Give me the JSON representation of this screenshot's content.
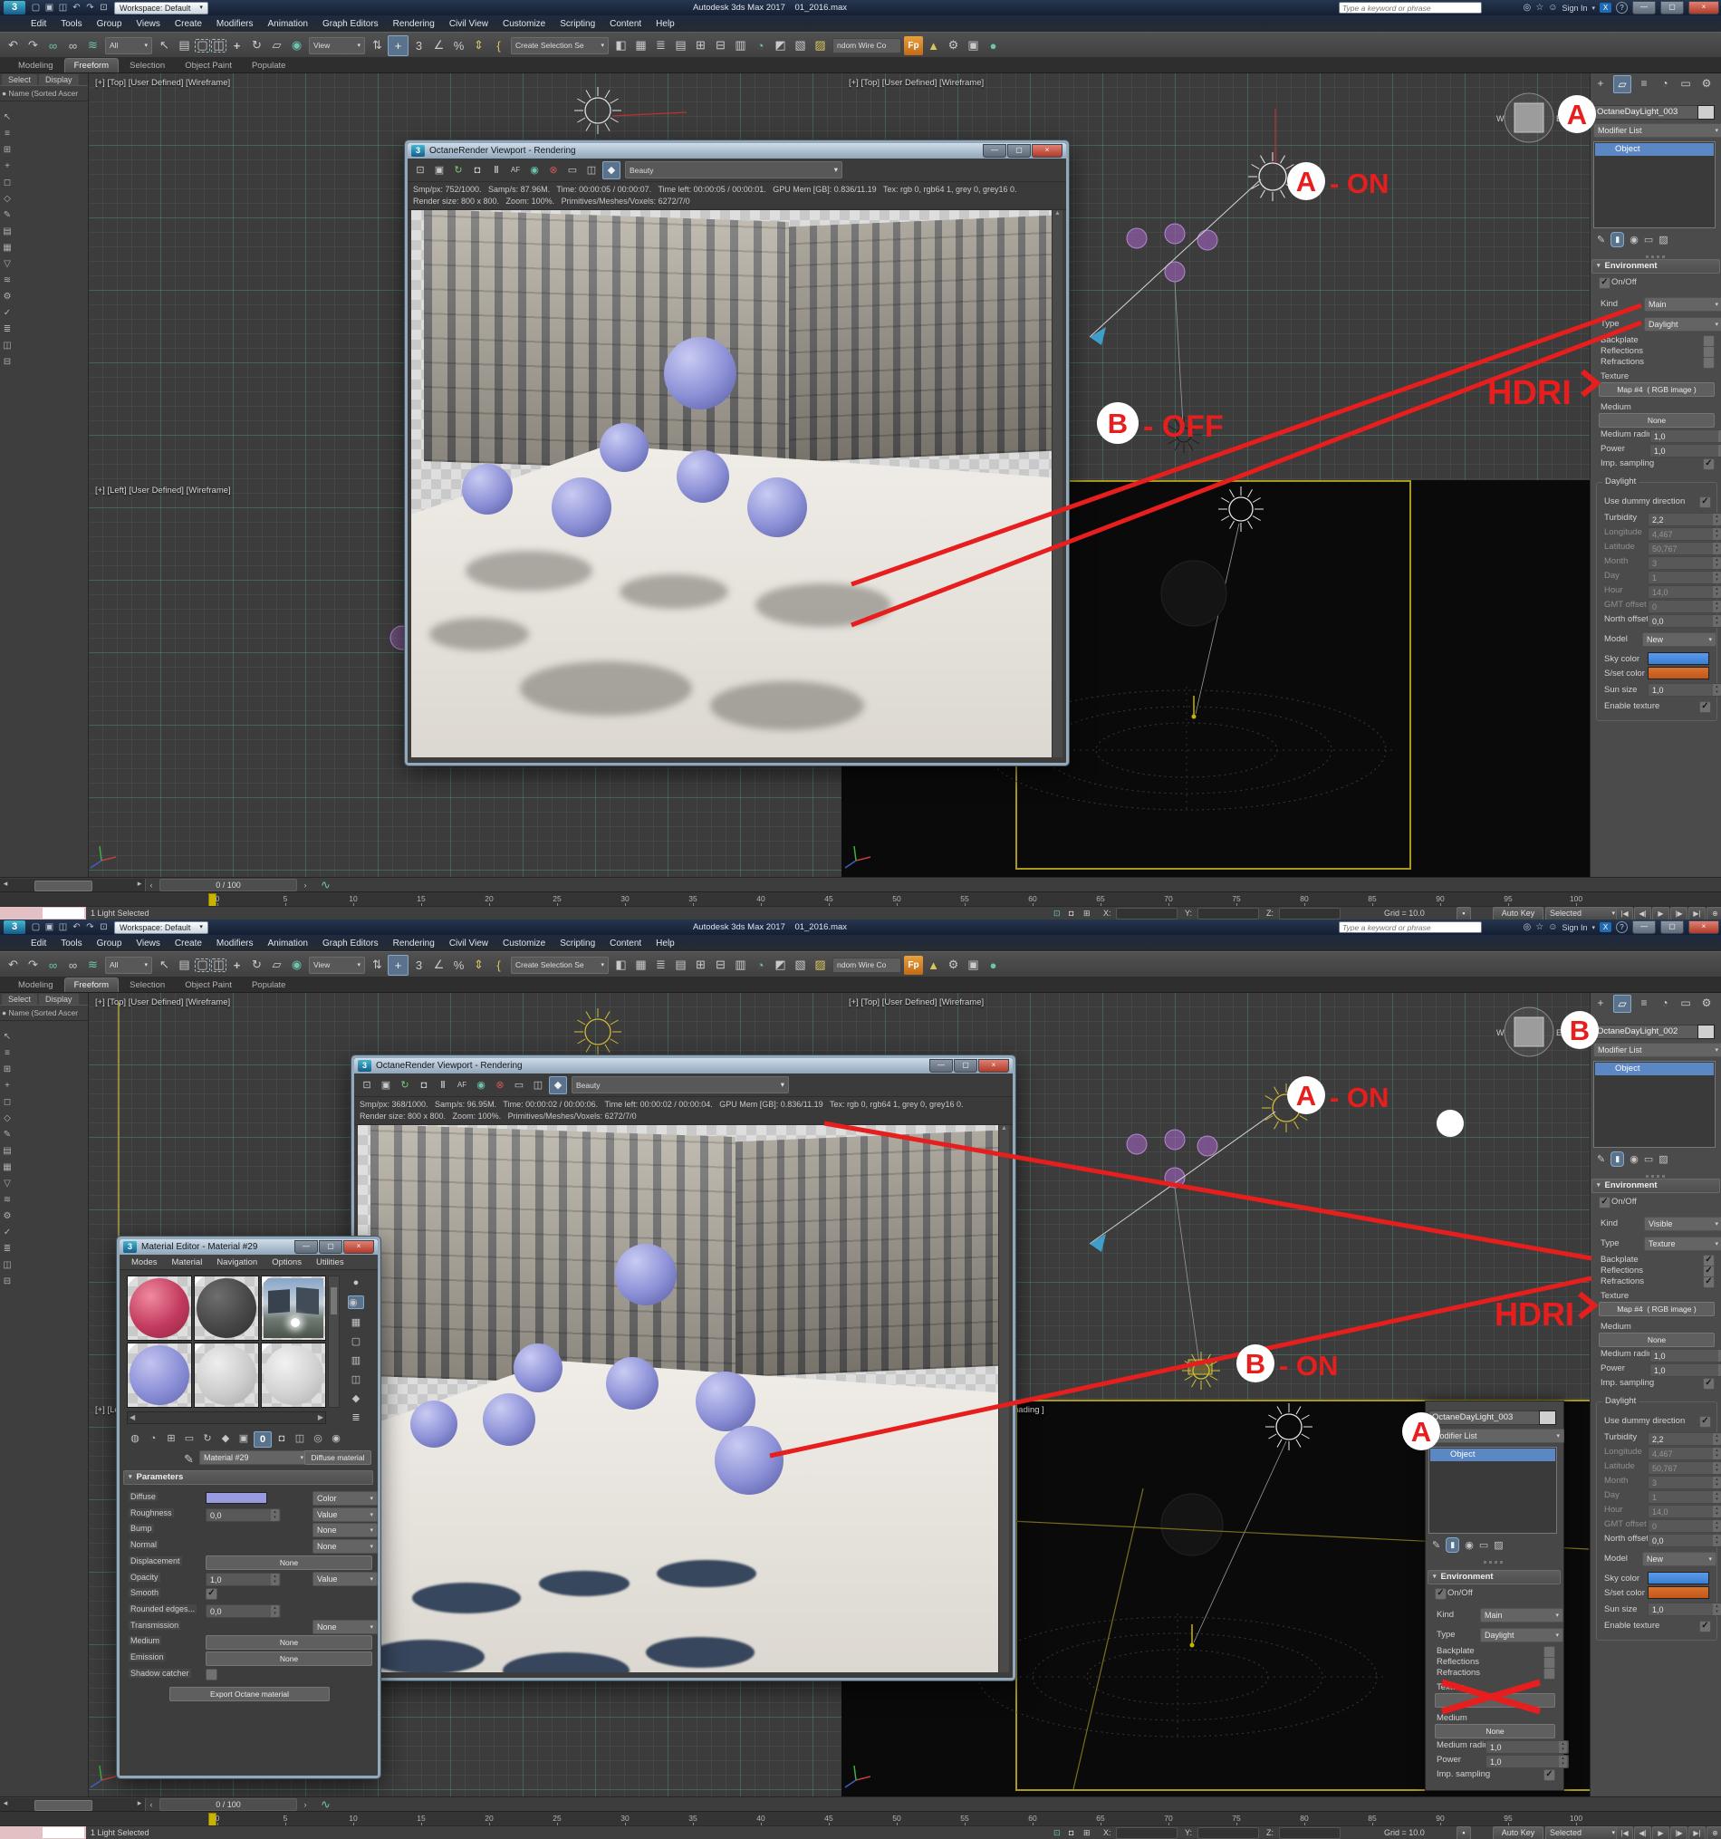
{
  "colors": {
    "annotation_red": "#e61e1e",
    "highlight_blue": "#5b87c5",
    "sky_color": "#3a7fd5",
    "sunset_color": "#c2571b",
    "diffuse_purple": "#9a9ade"
  },
  "app": {
    "window_title": "Autodesk 3ds Max 2017",
    "file_name": "01_2016.max",
    "workspace": "Workspace: Default",
    "search_placeholder": "Type a keyword or phrase",
    "sign_in": "Sign In",
    "menus": [
      "Edit",
      "Tools",
      "Group",
      "Views",
      "Create",
      "Modifiers",
      "Animation",
      "Graph Editors",
      "Rendering",
      "Civil View",
      "Customize",
      "Scripting",
      "Content",
      "Help"
    ],
    "ribbon_tabs": [
      "Modeling",
      "Freeform",
      "Selection",
      "Object Paint",
      "Populate"
    ],
    "toolbar": {
      "all": "All",
      "view": "View",
      "create_sel": "Create Selection Se",
      "named": "ndom Wire Co",
      "fp": "Fp"
    }
  },
  "explorer": {
    "tabs": [
      "Select",
      "Display"
    ],
    "header": "Name (Sorted Ascer"
  },
  "vp": {
    "tl": "[+] [Top] [User Defined] [Wireframe]",
    "bl": "[+] [Left] [User Defined] [Wireframe]",
    "tr": "[+] [Top] [User Defined] [Wireframe]",
    "br_partial": "hading ]",
    "cube_w": "W",
    "cube_e": "E"
  },
  "render_window": {
    "title": "OctaneRender Viewport - Rendering",
    "channel": "Beauty"
  },
  "panel": {
    "modifier_list": "Modifier List",
    "object_entry": "Object",
    "environment": "Environment",
    "on_off": "On/Off",
    "kind": "Kind",
    "type": "Type",
    "backplate": "Backplate",
    "reflections": "Reflections",
    "refractions": "Refractions",
    "texture": "Texture",
    "map_button": "Map #4  ( RGB image )",
    "medium": "Medium",
    "none": "None",
    "medium_radius": "Medium radius",
    "power": "Power",
    "imp_sampling": "Imp. sampling",
    "daylight": "Daylight",
    "use_dummy": "Use dummy direction",
    "turbidity": "Turbidity",
    "longitude": "Longitude",
    "latitude": "Latitude",
    "month": "Month",
    "day": "Day",
    "hour": "Hour",
    "gmt_offset": "GMT offset",
    "north_offset": "North offset",
    "model": "Model",
    "model_value": "New",
    "sky_color": "Sky color",
    "sset_color": "S/set color",
    "sun_size": "Sun size",
    "enable_texture": "Enable texture",
    "values": {
      "medium_radius": "1,0",
      "power": "1,0",
      "turbidity": "2,2",
      "longitude": "4,467",
      "latitude": "50,767",
      "month": "3",
      "day": "1",
      "hour": "14,0",
      "gmt_offset": "0",
      "north_offset": "0,0",
      "sun_size": "1,0"
    }
  },
  "timeline": {
    "range": "0 / 100",
    "ticks": [
      "0",
      "5",
      "10",
      "15",
      "20",
      "25",
      "30",
      "35",
      "40",
      "45",
      "50",
      "55",
      "60",
      "65",
      "70",
      "75",
      "80",
      "85",
      "90",
      "95",
      "100"
    ]
  },
  "status": {
    "selection": "1 Light Selected",
    "x_label": "X:",
    "y_label": "Y:",
    "z_label": "Z:",
    "grid": "Grid = 10.0",
    "auto_key": "Auto Key",
    "filter": "Selected"
  },
  "material_editor": {
    "title": "Material Editor - Material #29",
    "menus": [
      "Modes",
      "Material",
      "Navigation",
      "Options",
      "Utilities"
    ],
    "material_name": "Material #29",
    "type_button": "Diffuse material",
    "parameters": "Parameters",
    "export_button": "Export Octane material",
    "rows": [
      {
        "label": "Diffuse",
        "kind": "color",
        "right": "Color"
      },
      {
        "label": "Roughness",
        "kind": "spin",
        "value": "0,0",
        "right": "Value"
      },
      {
        "label": "Bump",
        "kind": "none",
        "right": "None"
      },
      {
        "label": "Normal",
        "kind": "none",
        "right": "None"
      },
      {
        "label": "Displacement",
        "kind": "wide",
        "wide": "None"
      },
      {
        "label": "Opacity",
        "kind": "spin",
        "value": "1,0",
        "right": "Value"
      },
      {
        "label": "Smooth",
        "kind": "check",
        "checked": true
      },
      {
        "label": "Rounded edges...",
        "kind": "spin",
        "value": "0,0"
      },
      {
        "label": "Transmission",
        "kind": "none",
        "right": "None"
      },
      {
        "label": "Medium",
        "kind": "wide",
        "wide": "None"
      },
      {
        "label": "Emission",
        "kind": "wide",
        "wide": "None"
      },
      {
        "label": "Shadow catcher",
        "kind": "check",
        "checked": false
      }
    ]
  },
  "screens": [
    {
      "light_name": "OctaneDayLight_003",
      "stats_line1": "Smp/px: 752/1000.   Samp/s: 87.96M.   Time: 00:00:05 / 00:00:07.   Time left: 00:00:05 / 00:00:01.   GPU Mem [GB]: 0.836/11.19   Tex: rgb 0, rgb64 1, grey 0, grey16 0.",
      "stats_line2": "Render size: 800 x 800.   Zoom: 100%.   Primitives/Meshes/Voxels: 6272/7/0",
      "env": {
        "kind": "Main",
        "type": "Daylight",
        "on_off": true,
        "backplate": false,
        "reflections": false,
        "refractions": false,
        "imp_sampling": true,
        "use_dummy": true,
        "enable_texture": true
      },
      "annotations": {
        "a_letter": "A",
        "a_state": "- ON",
        "b_letter": "B",
        "b_state": "- OFF",
        "hdri": "HDRI"
      }
    },
    {
      "light_name": "OctaneDayLight_002",
      "stats_line1": "Smp/px: 368/1000.   Samp/s: 96.95M.   Time: 00:00:02 / 00:00:06.   Time left: 00:00:02 / 00:00:04.   GPU Mem [GB]: 0.836/11.19   Tex: rgb 0, rgb64 1, grey 0, grey16 0.",
      "stats_line2": "Render size: 800 x 800.   Zoom: 100%.   Primitives/Meshes/Voxels: 6272/7/0",
      "env": {
        "kind": "Visible",
        "type": "Texture",
        "on_off": true,
        "backplate": true,
        "reflections": true,
        "refractions": true,
        "imp_sampling": true,
        "use_dummy": true,
        "enable_texture": true
      },
      "overlay_light_name": "OctaneDayLight_003",
      "overlay_env": {
        "kind": "Main",
        "type": "Daylight",
        "on_off": true,
        "backplate": false,
        "reflections": false,
        "refractions": false,
        "imp_sampling": true
      },
      "annotations": {
        "a_letter": "A",
        "a_state": "- ON",
        "b_letter": "B",
        "b_state": "- ON",
        "hdri": "HDRI"
      }
    }
  ]
}
